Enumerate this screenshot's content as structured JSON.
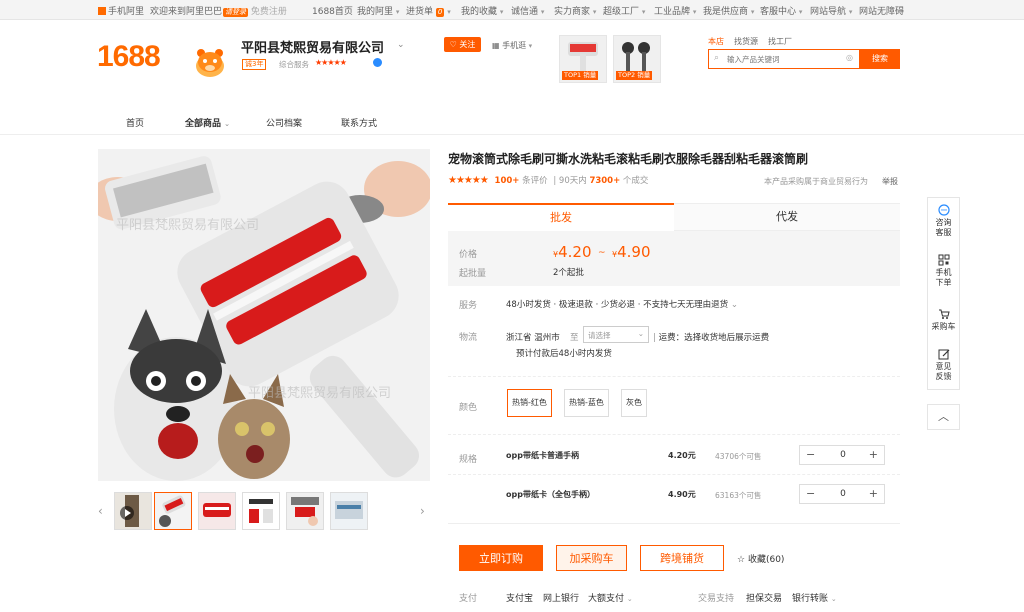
{
  "topbar": {
    "mobile": "手机阿里",
    "welcome": "欢迎来到阿里巴巴",
    "login_hint": "请登录",
    "register": "免费注册",
    "home": "1688首页",
    "my_ali": "我的阿里",
    "purchase_list": "进货单",
    "purchase_count": "0",
    "favorites": "我的收藏",
    "buy_text": "诚信通",
    "strength": "实力商家",
    "super_factory": "超级工厂",
    "industry": "工业品牌",
    "supplier": "我是供应商",
    "service": "客服中心",
    "site_nav": "网站导航",
    "accessible": "网站无障碍"
  },
  "header": {
    "logo": "1688",
    "shop_name": "平阳县梵熙贸易有限公司",
    "years_badge": "诚3年",
    "service_label": "综合服务",
    "stars": "★★★★★",
    "follow": "关注",
    "mobile_shop": "手机逛",
    "top1_label": "TOP1 销量",
    "top2_label": "TOP2 销量",
    "search_tabs": [
      "本店",
      "找货源",
      "找工厂"
    ],
    "search_placeholder": "输入产品关键词",
    "search_button": "搜索"
  },
  "nav": [
    "首页",
    "全部商品",
    "公司档案",
    "联系方式"
  ],
  "product": {
    "title": "宠物滚筒式除毛刷可撕水洗粘毛滚粘毛刷衣服除毛器刮粘毛器滚筒刷",
    "stars": "★★★★★",
    "review_count": "100+",
    "review_label": "条评价",
    "sales_period": "90天内",
    "sales_count": "7300+",
    "sales_unit": "个成交",
    "purchase_note": "本产品采购属于商业贸易行为",
    "report": "举报",
    "tab_wholesale": "批发",
    "tab_dropship": "代发",
    "price_label": "价格",
    "price_low": "4.20",
    "price_high": "4.90",
    "currency": "¥",
    "price_sep": "~",
    "moq_label": "起批量",
    "moq_value": "2个起批",
    "service_label": "服务",
    "service_value": "48小时发货 · 极速退款 · 少货必退 · 不支持七天无理由退货",
    "logistics_label": "物流",
    "origin": "浙江省 温州市",
    "to": "至",
    "region_placeholder": "请选择",
    "freight": "运费：选择收货地后展示运费",
    "ship_time": "预计付款后48小时内发货",
    "color_label": "颜色",
    "colors": [
      "热销-红色",
      "热销-蓝色",
      "灰色"
    ],
    "spec_label": "规格",
    "specs": [
      {
        "name": "opp带纸卡普通手柄",
        "price": "4.20元",
        "stock": "43706个可售",
        "qty": "0"
      },
      {
        "name": "opp带纸卡（全包手柄）",
        "price": "4.90元",
        "stock": "63163个可售",
        "qty": "0"
      }
    ],
    "buy_now": "立即订购",
    "add_cart": "加采购车",
    "cross_border": "跨境铺货",
    "collect": "收藏(60)",
    "pay_label": "支付",
    "pay_methods": [
      "支付宝",
      "网上银行",
      "大额支付"
    ],
    "trade_label": "交易支持",
    "trade_methods": [
      "担保交易",
      "银行转账"
    ]
  },
  "gallery": {
    "watermark": "平阳县梵熙贸易有限公司",
    "thumb_count": 6
  },
  "sidebar": {
    "consult": "咨询客服",
    "mobile_order": "手机下单",
    "cart": "采购车",
    "feedback": "意见反馈"
  },
  "colors": {
    "accent": "#ff5a00",
    "logo": "#ff6a00"
  }
}
